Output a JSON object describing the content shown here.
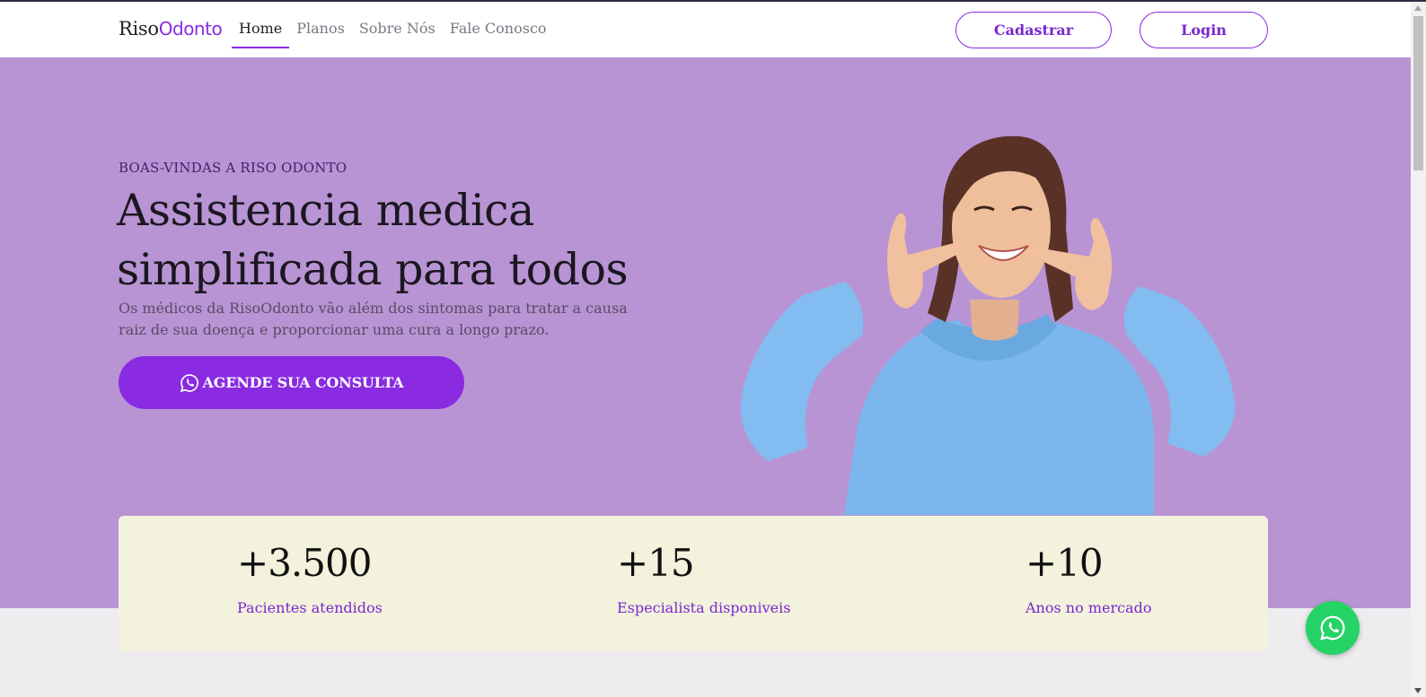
{
  "nav": {
    "logo_primary": "Riso",
    "logo_accent": "Odonto",
    "links": [
      "Home",
      "Planos",
      "Sobre Nós",
      "Fale Conosco"
    ],
    "signup_label": "Cadastrar",
    "login_label": "Login"
  },
  "hero": {
    "kicker": "BOAS-VINDAS A RISO ODONTO",
    "headline_line1": "Assistencia medica",
    "headline_line2": "simplificada para todos",
    "subtext": "Os médicos da RisoOdonto vão além dos sintomas para tratar a causa raiz de sua doença e proporcionar uma cura a longo prazo.",
    "cta_label": "AGENDE SUA CONSULTA",
    "cta_icon": "whatsapp-icon"
  },
  "stats": [
    {
      "value": "+3.500",
      "label": "Pacientes atendidos"
    },
    {
      "value": "+15",
      "label": "Especialista disponiveis"
    },
    {
      "value": "+10",
      "label": "Anos no mercado"
    }
  ],
  "colors": {
    "accent": "#8a2be2",
    "hero_bg": "#b894d4",
    "stats_bg": "#f3f2dc",
    "whatsapp": "#25d366"
  }
}
